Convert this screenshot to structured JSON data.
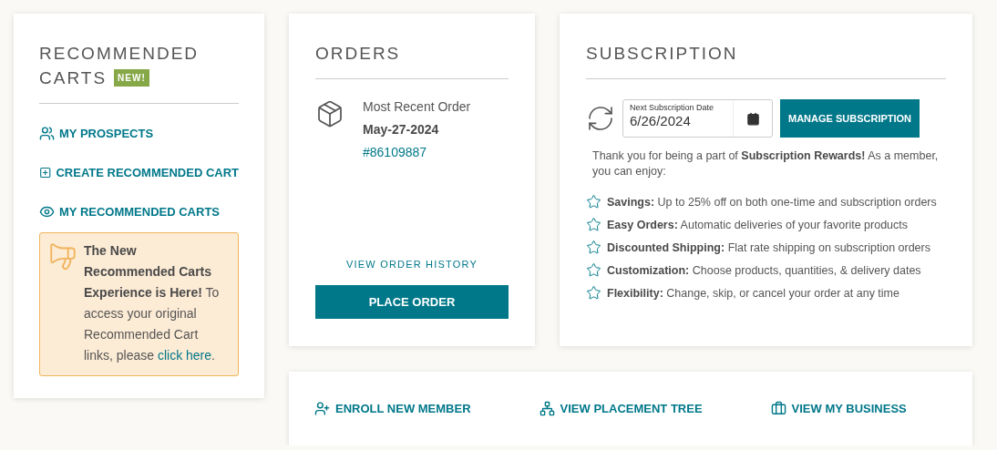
{
  "recommended_carts": {
    "title_lines": [
      "RECOMMENDED",
      "CARTS"
    ],
    "badge": "NEW!",
    "links": [
      {
        "kind": "prospects",
        "label": "MY PROSPECTS"
      },
      {
        "kind": "create",
        "label": "CREATE RECOMMENDED CART"
      },
      {
        "kind": "view",
        "label": "MY RECOMMENDED CARTS"
      }
    ],
    "notice": {
      "title": "The New Recommended Carts Experience is Here!",
      "text": "To access your original Recommended Cart links, please",
      "link": "click here",
      "end": "."
    }
  },
  "orders": {
    "title": "ORDERS",
    "caption": "Most Recent Order",
    "date": "May-27-2024",
    "number": "#86109887",
    "history_link": "VIEW ORDER HISTORY",
    "button": "PLACE ORDER"
  },
  "subscription": {
    "title": "SUBSCRIPTION",
    "date_field": {
      "label": "Next Subscription Date",
      "value": "6/26/2024"
    },
    "button": "MANAGE SUBSCRIPTION",
    "intro": "Thank you for being a part of **Subscription Rewards!** As a member, you can enjoy:",
    "benefits": [
      "**Savings:** Up to 25% off on both one-time and subscription orders",
      "**Easy Orders:** Automatic deliveries of your favorite products",
      "**Discounted Shipping:** Flat rate shipping on subscription orders",
      "**Customization:** Choose products, quantities, & delivery dates",
      "**Flexibility:** Change, skip, or cancel your order at any time"
    ]
  },
  "quick_links": [
    {
      "kind": "enroll",
      "label": "ENROLL NEW MEMBER"
    },
    {
      "kind": "tree",
      "label": "VIEW PLACEMENT TREE"
    },
    {
      "kind": "business",
      "label": "VIEW MY BUSINESS"
    }
  ]
}
